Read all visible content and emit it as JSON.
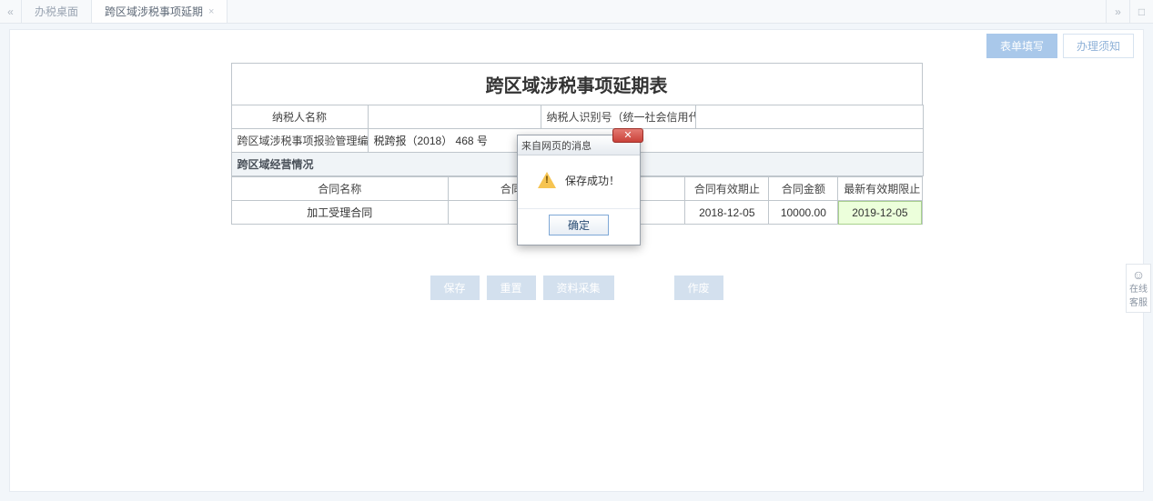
{
  "tabs": {
    "desktop": "办税桌面",
    "current": "跨区域涉税事项延期"
  },
  "pageTabs": {
    "form_fill": "表单填写",
    "process_info": "办理须知"
  },
  "form": {
    "title": "跨区域涉税事项延期表",
    "labels": {
      "taxpayer_name": "纳税人名称",
      "taxpayer_id": "纳税人识别号（统一社会信用代码）",
      "mgmt_no": "跨区域涉税事项报验管理编号",
      "section_operation": "跨区域经营情况"
    },
    "values": {
      "taxpayer_name": "",
      "taxpayer_id": "",
      "mgmt_no": "税跨报（2018） 468 号"
    },
    "grid": {
      "headers": {
        "contract_name": "合同名称",
        "contract_no": "合同编号",
        "valid_to": "合同有效期止",
        "amount": "合同金额",
        "new_valid_to": "最新有效期限止"
      },
      "row": {
        "contract_name": "加工受理合同",
        "contract_no": "",
        "valid_to": "2018-12-05",
        "amount": "10000.00",
        "new_valid_to": "2019-12-05"
      }
    }
  },
  "actions": {
    "save": "保存",
    "reset": "重置",
    "docs": "资料采集",
    "cancel": "作废"
  },
  "modal": {
    "title": "来自网页的消息",
    "message": "保存成功！",
    "ok": "确定"
  },
  "support": {
    "line1": "在线",
    "line2": "客服"
  }
}
